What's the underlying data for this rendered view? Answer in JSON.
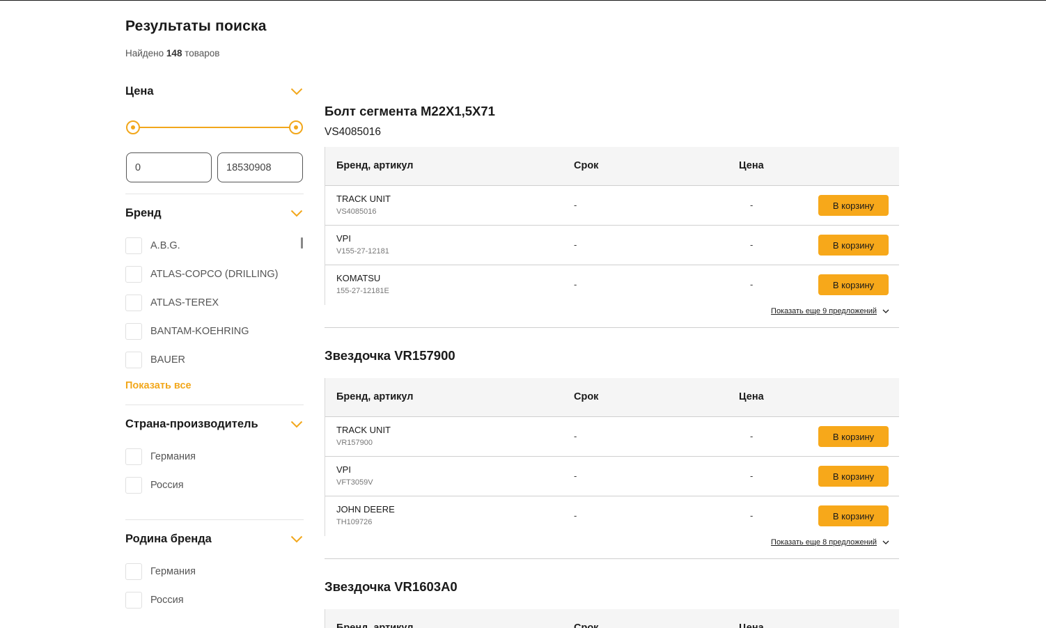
{
  "header": {
    "title": "Результаты поиска",
    "found_prefix": "Найдено",
    "found_count": "148",
    "found_suffix": "товаров"
  },
  "filters": {
    "price": {
      "title": "Цена",
      "min_value": "0",
      "max_value": "18530908"
    },
    "brand": {
      "title": "Бренд",
      "options": [
        "A.B.G.",
        "ATLAS-COPCO (DRILLING)",
        "ATLAS-TEREX",
        "BANTAM-KOEHRING",
        "BAUER"
      ],
      "show_all": "Показать все"
    },
    "country": {
      "title": "Страна-производитель",
      "options": [
        "Германия",
        "Россия"
      ]
    },
    "brand_home": {
      "title": "Родина бренда",
      "options": [
        "Германия",
        "Россия"
      ]
    }
  },
  "table_headers": {
    "brand_sku": "Бренд, артикул",
    "term": "Срок",
    "price": "Цена"
  },
  "cart_label": "В корзину",
  "products": [
    {
      "title": "Болт сегмента M22X1,5X71",
      "code": "VS4085016",
      "offers": [
        {
          "brand": "TRACK UNIT",
          "sku": "VS4085016",
          "term": "-",
          "price": "-"
        },
        {
          "brand": "VPI",
          "sku": "V155-27-12181",
          "term": "-",
          "price": "-"
        },
        {
          "brand": "KOMATSU",
          "sku": "155-27-12181E",
          "term": "-",
          "price": "-"
        }
      ],
      "more": "Показать еще 9 предложений"
    },
    {
      "title": "Звездочка VR157900",
      "offers": [
        {
          "brand": "TRACK UNIT",
          "sku": "VR157900",
          "term": "-",
          "price": "-"
        },
        {
          "brand": "VPI",
          "sku": "VFT3059V",
          "term": "-",
          "price": "-"
        },
        {
          "brand": "JOHN DEERE",
          "sku": "TH109726",
          "term": "-",
          "price": "-"
        }
      ],
      "more": "Показать еще 8 предложений"
    },
    {
      "title": "Звездочка VR1603A0"
    }
  ],
  "colors": {
    "accent": "#f7a81a",
    "header_bg": "#f5f5f5"
  }
}
